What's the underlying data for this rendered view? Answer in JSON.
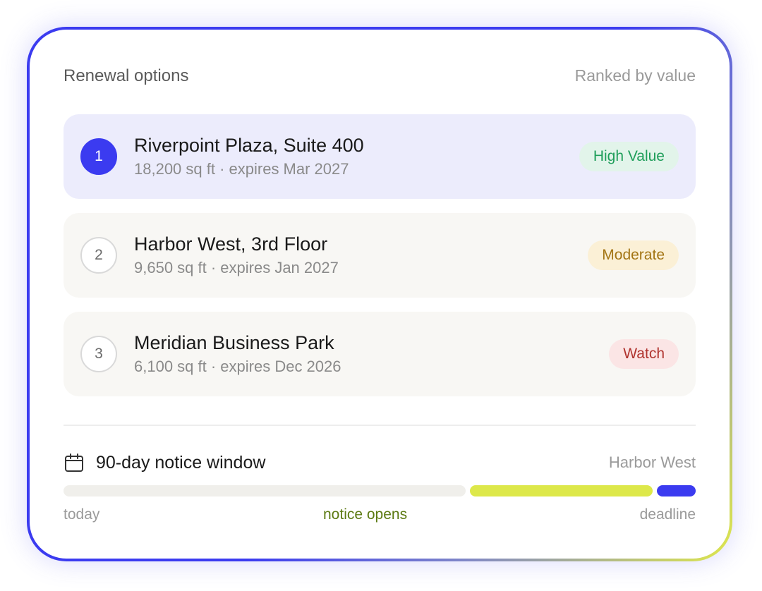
{
  "header": {
    "title": "Renewal options",
    "subtitle": "Ranked by value"
  },
  "options": [
    {
      "rank": "1",
      "name": "Riverpoint Plaza, Suite 400",
      "meta": "18,200 sq ft · expires Mar 2027",
      "badge": "High Value",
      "selected": true
    },
    {
      "rank": "2",
      "name": "Harbor West, 3rd Floor",
      "meta": "9,650 sq ft · expires Jan 2027",
      "badge": "Moderate",
      "selected": false
    },
    {
      "rank": "3",
      "name": "Meridian Business Park",
      "meta": "6,100 sq ft · expires Dec 2026",
      "badge": "Watch",
      "selected": false
    }
  ],
  "notice": {
    "icon": "calendar-icon",
    "title": "90-day notice window",
    "target": "Harbor West",
    "labels": {
      "today": "today",
      "opens": "notice opens",
      "deadline": "deadline"
    },
    "timeline": {
      "notice_opens_fraction": 0.64,
      "deadline_marker_fraction": 0.935
    }
  },
  "colors": {
    "accent": "#3b3bf0",
    "window": "#dde84a",
    "high_value": "#1f9e5a",
    "moderate": "#a37514",
    "watch": "#b0332e"
  }
}
